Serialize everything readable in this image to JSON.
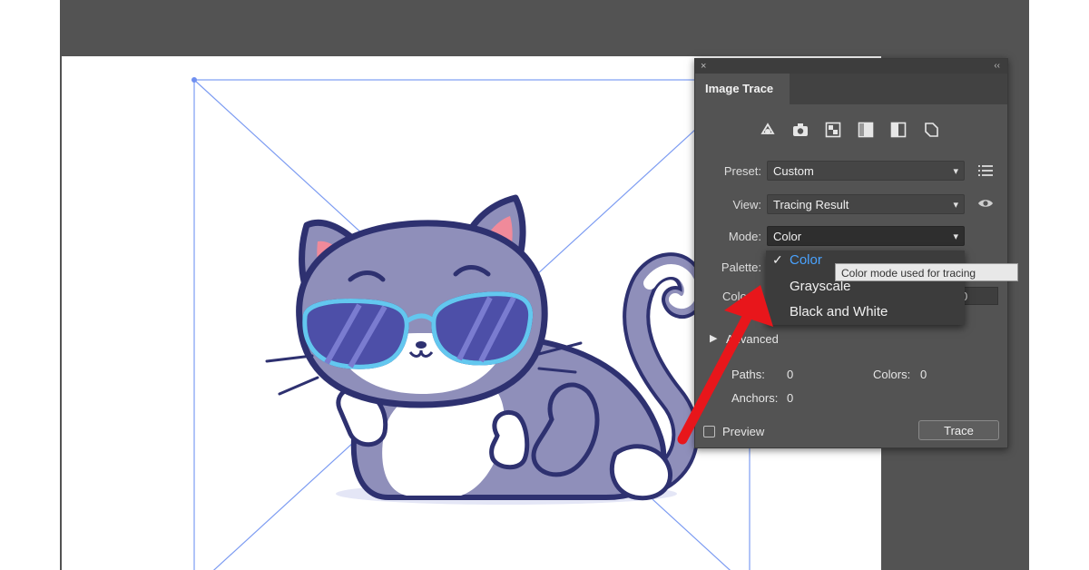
{
  "panel": {
    "title": "Image Trace",
    "close_icon": "×",
    "collapse_icon": "‹‹",
    "preset_icons": [
      "auto-color-icon",
      "high-color-icon",
      "low-color-icon",
      "grayscale-icon",
      "black-and-white-icon",
      "outline-icon"
    ],
    "preset": {
      "label": "Preset:",
      "value": "Custom"
    },
    "view": {
      "label": "View:",
      "value": "Tracing Result"
    },
    "mode": {
      "label": "Mode:",
      "value": "Color"
    },
    "palette": {
      "label": "Palette:"
    },
    "colors": {
      "label": "Colo",
      "value": "0"
    },
    "advanced": {
      "label": "Advanced"
    },
    "stats": {
      "paths_label": "Paths:",
      "paths_value": "0",
      "colors_label": "Colors:",
      "colors_value": "0",
      "anchors_label": "Anchors:",
      "anchors_value": "0"
    },
    "preview_label": "Preview",
    "trace_button": "Trace"
  },
  "mode_dropdown": {
    "check": "✓",
    "options": [
      "Color",
      "Grayscale",
      "Black and White"
    ],
    "selected": "Color"
  },
  "tooltip": "Color mode used for tracing",
  "colors": {
    "workspace": "#535353",
    "panel": "#535353",
    "highlight": "#4aa3ff",
    "arrow": "#e8161b",
    "bounding_box": "#6f8ff0"
  }
}
